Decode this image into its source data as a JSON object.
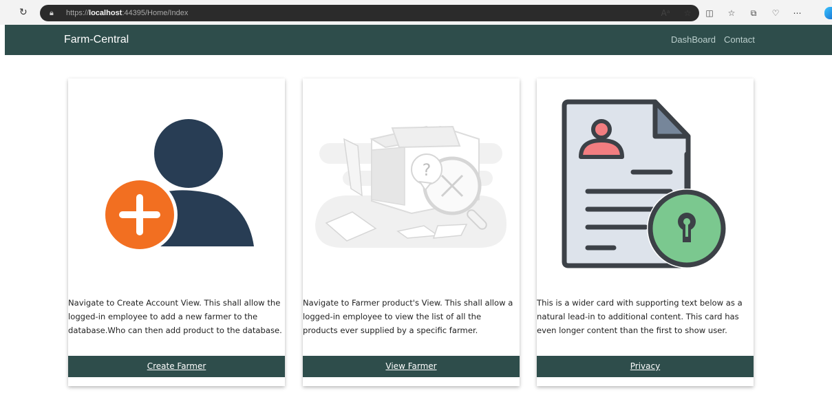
{
  "browser": {
    "url_prefix": "https://",
    "url_host": "localhost",
    "url_rest": ":44395/Home/Index",
    "icons": [
      "reload-icon",
      "lock-icon",
      "read-aloud-icon",
      "favorite-star-icon",
      "split-screen-icon",
      "favorites-icon",
      "collections-icon",
      "copilot-icon",
      "more-icon"
    ]
  },
  "navbar": {
    "brand": "Farm-Central",
    "links": [
      "DashBoard",
      "Contact"
    ]
  },
  "cards": [
    {
      "text": "Navigate to Create Account View. This shall allow the logged-in employee to add a new farmer to the database.Who can then add product to the database.",
      "link": "Create Farmer",
      "icon": "add-user-icon"
    },
    {
      "text": "Navigate to Farmer product's View. This shall allow a logged-in employee to view the list of all the products ever supplied by a specific farmer.",
      "link": "View Farmer",
      "icon": "empty-box-search-icon"
    },
    {
      "text": "This is a wider card with supporting text below as a natural lead-in to additional content. This card has even longer content than the first to show user.",
      "link": "Privacy",
      "icon": "locked-document-icon"
    }
  ],
  "colors": {
    "nav_bg": "#2e4d4b",
    "accent_orange": "#f26f21",
    "user_navy": "#283d54",
    "lock_green": "#7bc88f",
    "person_pink": "#f27d80"
  }
}
